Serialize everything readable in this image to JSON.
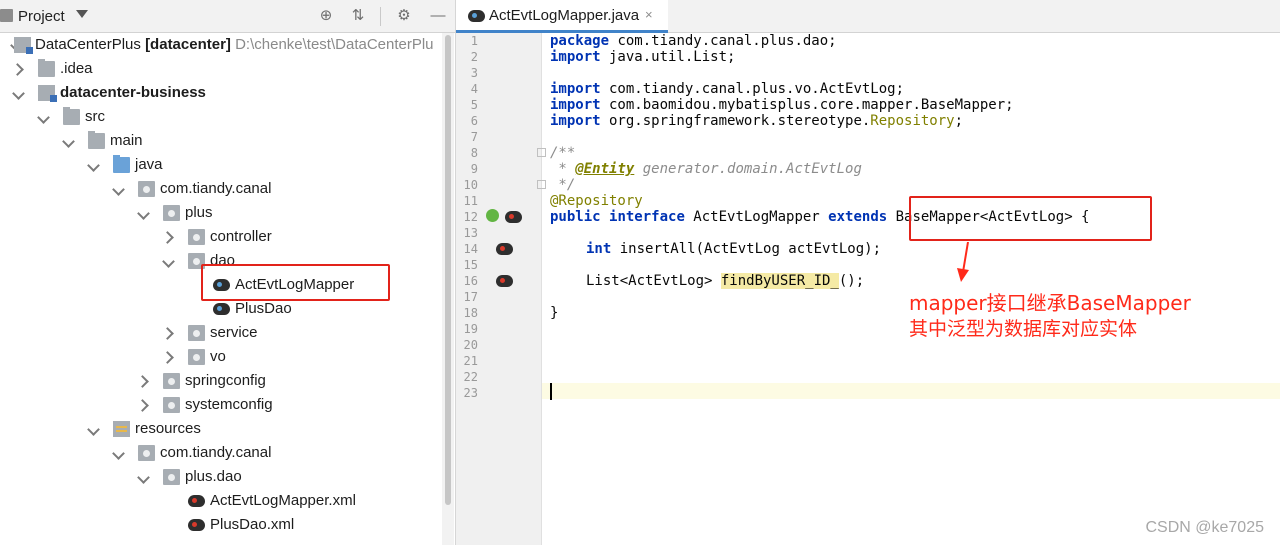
{
  "project_panel": {
    "title": "Project",
    "tree": [
      {
        "label": "DataCenterPlus",
        "suffix": "[datacenter]",
        "path": "D:\\chenke\\test\\DataCenterPlu"
      },
      {
        "label": ".idea"
      },
      {
        "label": "datacenter-business"
      },
      {
        "label": "src"
      },
      {
        "label": "main"
      },
      {
        "label": "java"
      },
      {
        "label": "com.tiandy.canal"
      },
      {
        "label": "plus"
      },
      {
        "label": "controller"
      },
      {
        "label": "dao"
      },
      {
        "label": "ActEvtLogMapper"
      },
      {
        "label": "PlusDao"
      },
      {
        "label": "service"
      },
      {
        "label": "vo"
      },
      {
        "label": "springconfig"
      },
      {
        "label": "systemconfig"
      },
      {
        "label": "resources"
      },
      {
        "label": "com.tiandy.canal"
      },
      {
        "label": "plus.dao"
      },
      {
        "label": "ActEvtLogMapper.xml"
      },
      {
        "label": "PlusDao.xml"
      }
    ]
  },
  "editor": {
    "tab_label": "ActEvtLogMapper.java",
    "tab_close": "×",
    "line_numbers": [
      "1",
      "2",
      "3",
      "4",
      "5",
      "6",
      "7",
      "8",
      "9",
      "10",
      "11",
      "12",
      "13",
      "14",
      "15",
      "16",
      "17",
      "18",
      "19",
      "20",
      "21",
      "22",
      "23"
    ],
    "code": {
      "l1_kw": "package",
      "l1_rest": " com.tiandy.canal.plus.dao;",
      "l2_kw": "import",
      "l2_rest": " java.util.List;",
      "l4_kw": "import",
      "l4_rest": " com.tiandy.canal.plus.vo.ActEvtLog;",
      "l5_kw": "import",
      "l5_rest": " com.baomidou.mybatisplus.core.mapper.BaseMapper;",
      "l6_kw": "import",
      "l6_rest": " org.springframework.stereotype.",
      "l6_ann": "Repository",
      "l6_end": ";",
      "l8": "/**",
      "l9_pre": " * ",
      "l9_tag": "@Entity",
      "l9_rest": " generator.domain.ActEvtLog",
      "l10": " */",
      "l11": "@Repository",
      "l12_kw1": "public",
      "l12_kw2": "interface",
      "l12_name": " ActEvtLogMapper ",
      "l12_kw3": "extends",
      "l12_rest": " BaseMapper<ActEvtLog> {",
      "l14_kw": "int",
      "l14_rest": " insertAll(ActEvtLog actEvtLog);",
      "l16_pre": "List<ActEvtLog> ",
      "l16_hl": "findByUSER_ID_",
      "l16_end": "();",
      "l18": "}"
    }
  },
  "annotation": {
    "line1": "mapper接口继承BaseMapper",
    "line2": "其中泛型为数据库对应实体",
    "color": "#ff2a1a"
  },
  "watermark": "CSDN @ke7025"
}
